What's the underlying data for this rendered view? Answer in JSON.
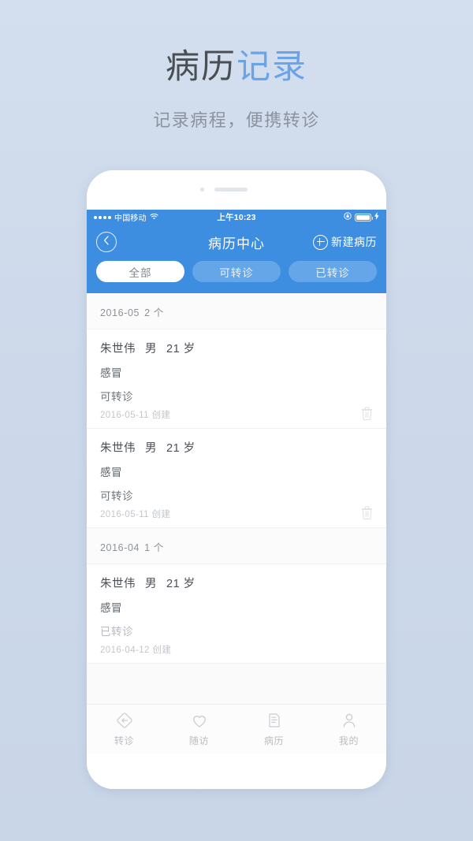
{
  "promo": {
    "title_dark": "病历",
    "title_accent": "记录",
    "subtitle": "记录病程，便携转诊",
    "accent_color": "#6ba3e8"
  },
  "phone": {
    "status_bar": {
      "carrier": "中国移动",
      "time": "上午10:23",
      "signal_dots": 4,
      "wifi_icon": "wifi-icon",
      "lock_icon": "rotation-lock-icon",
      "battery_icon": "battery-icon",
      "charging_icon": "lightning-bolt-icon"
    },
    "navbar": {
      "back_icon": "chevron-left-circle-icon",
      "title": "病历中心",
      "add_icon": "plus-circle-icon",
      "add_label": "新建病历",
      "background_color": "#3d8ee0"
    },
    "segments": [
      {
        "label": "全部",
        "active": true
      },
      {
        "label": "可转诊",
        "active": false
      },
      {
        "label": "已转诊",
        "active": false
      }
    ],
    "sections": [
      {
        "month": "2016-05",
        "count": "2 个",
        "records": [
          {
            "name": "朱世伟",
            "gender": "男",
            "age": "21 岁",
            "diagnosis": "感冒",
            "status": "可转诊",
            "status_done": false,
            "date": "2016-05-11 创建",
            "delete_icon": "trash-icon",
            "has_delete": true
          },
          {
            "name": "朱世伟",
            "gender": "男",
            "age": "21 岁",
            "diagnosis": "感冒",
            "status": "可转诊",
            "status_done": false,
            "date": "2016-05-11 创建",
            "delete_icon": "trash-icon",
            "has_delete": true
          }
        ]
      },
      {
        "month": "2016-04",
        "count": "1 个",
        "records": [
          {
            "name": "朱世伟",
            "gender": "男",
            "age": "21 岁",
            "diagnosis": "感冒",
            "status": "已转诊",
            "status_done": true,
            "date": "2016-04-12 创建",
            "delete_icon": "trash-icon",
            "has_delete": false
          }
        ]
      }
    ],
    "tabbar": [
      {
        "label": "转诊",
        "icon": "referral-diamond-icon"
      },
      {
        "label": "随访",
        "icon": "heart-icon"
      },
      {
        "label": "病历",
        "icon": "document-icon"
      },
      {
        "label": "我的",
        "icon": "person-icon"
      }
    ]
  }
}
